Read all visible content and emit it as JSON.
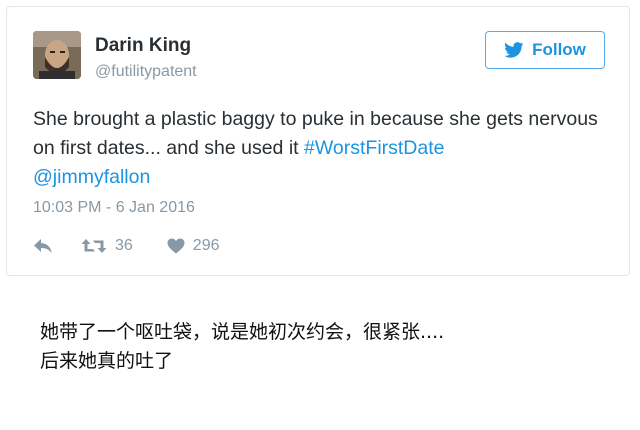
{
  "tweet": {
    "display_name": "Darin King",
    "username": "@futilitypatent",
    "follow_label": "Follow",
    "text_part1": "She brought a plastic baggy to puke in because she gets nervous on first dates... and she used it ",
    "hashtag": "#WorstFirstDate",
    "mention": "@jimmyfallon",
    "timestamp": "10:03 PM - 6 Jan 2016",
    "retweet_count": "36",
    "like_count": "296",
    "icons": {
      "follow": "twitter-bird-icon",
      "reply": "reply-icon",
      "retweet": "retweet-icon",
      "like": "heart-icon"
    },
    "colors": {
      "link": "#1b95e0",
      "muted": "#8899a6",
      "text": "#292f33",
      "border": "#e1e8ed"
    }
  },
  "caption": {
    "line1": "她带了一个呕吐袋，说是她初次约会，很紧张....",
    "line2": "后来她真的吐了"
  }
}
